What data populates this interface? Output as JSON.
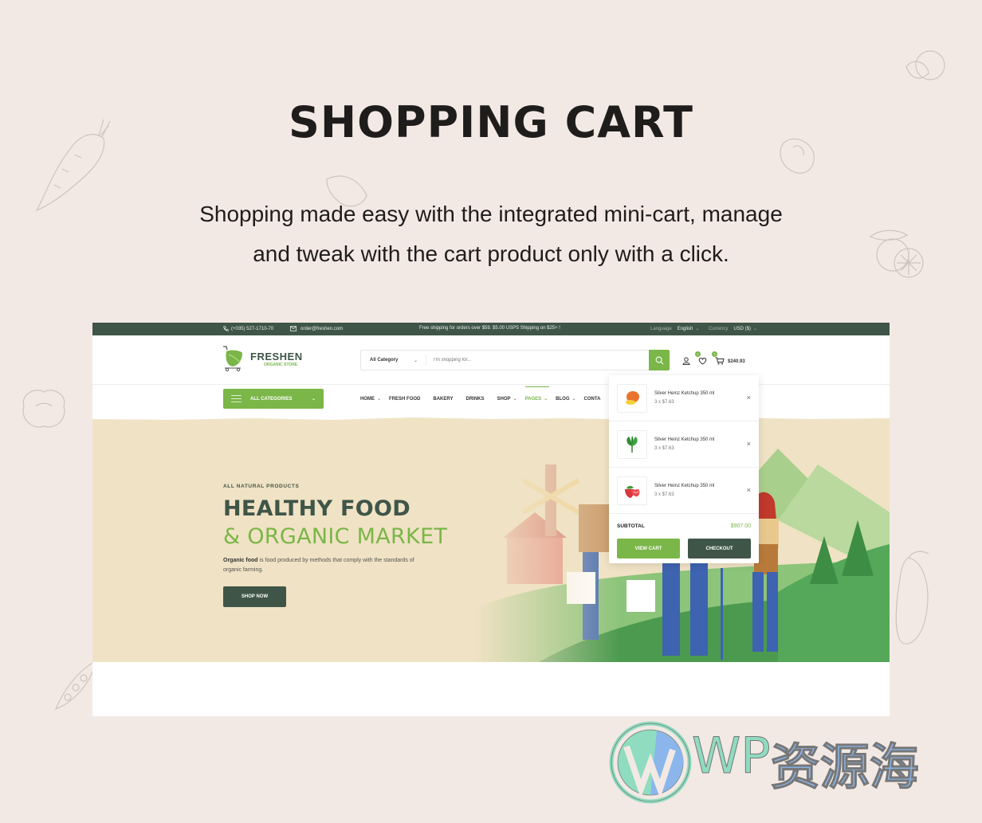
{
  "promo": {
    "title": "SHOPPING CART",
    "subtitle_line1": "Shopping made easy with the integrated mini-cart, manage",
    "subtitle_line2": "and tweak with the cart product only with a click."
  },
  "topbar": {
    "phone": "(+035) 527-1710-70",
    "email": "order@freshen.com",
    "shipping_notice": "Free shipping for orders over $59. $5.00 USPS Shipping on $25+ !",
    "language_label": "Language",
    "language_value": "English",
    "currency_label": "Currency",
    "currency_value": "USD ($)"
  },
  "header": {
    "logo_name": "FRESHEN",
    "logo_tagline": "ORGANIC STORE",
    "search_category": "All Category",
    "search_placeholder": "I'm shopping for...",
    "wishlist_count": "0",
    "cart_count": "3",
    "cart_total": "$240.93"
  },
  "nav": {
    "all_categories": "ALL CATEGORIES",
    "items": [
      {
        "label": "HOME",
        "dropdown": true
      },
      {
        "label": "FRESH FOOD",
        "dropdown": false
      },
      {
        "label": "BAKERY",
        "dropdown": false
      },
      {
        "label": "DRINKS",
        "dropdown": false
      },
      {
        "label": "SHOP",
        "dropdown": true
      },
      {
        "label": "PAGES",
        "dropdown": true,
        "active": true
      },
      {
        "label": "BLOG",
        "dropdown": true
      },
      {
        "label": "CONTA",
        "dropdown": false
      }
    ]
  },
  "hero": {
    "eyebrow": "ALL NATURAL PRODUCTS",
    "title_line1": "HEALTHY FOOD",
    "title_line2": "& ORGANIC MARKET",
    "desc_bold": "Organic food",
    "desc_rest": " is food produced by methods that comply with the standards of organic farming.",
    "cta": "SHOP NOW"
  },
  "minicart": {
    "items": [
      {
        "name": "Silver Heinz Ketchup 350 ml",
        "qty": "3 x $7.63",
        "image": "mango"
      },
      {
        "name": "Silver Heinz Ketchup 350 ml",
        "qty": "3 x $7.63",
        "image": "spinach"
      },
      {
        "name": "Silver Heinz Ketchup 350 ml",
        "qty": "3 x $7.63",
        "image": "strawberry"
      }
    ],
    "subtotal_label": "SUBTOTAL",
    "subtotal_value": "$907.00",
    "view_cart": "VIEW CART",
    "checkout": "CHECKOUT"
  },
  "watermark": {
    "latin": "WP",
    "chinese": "资源海"
  },
  "colors": {
    "brand_green": "#7ab648",
    "dark_green": "#3f5548",
    "page_bg": "#f3e9e4",
    "hero_bg": "#f0e2c4"
  }
}
